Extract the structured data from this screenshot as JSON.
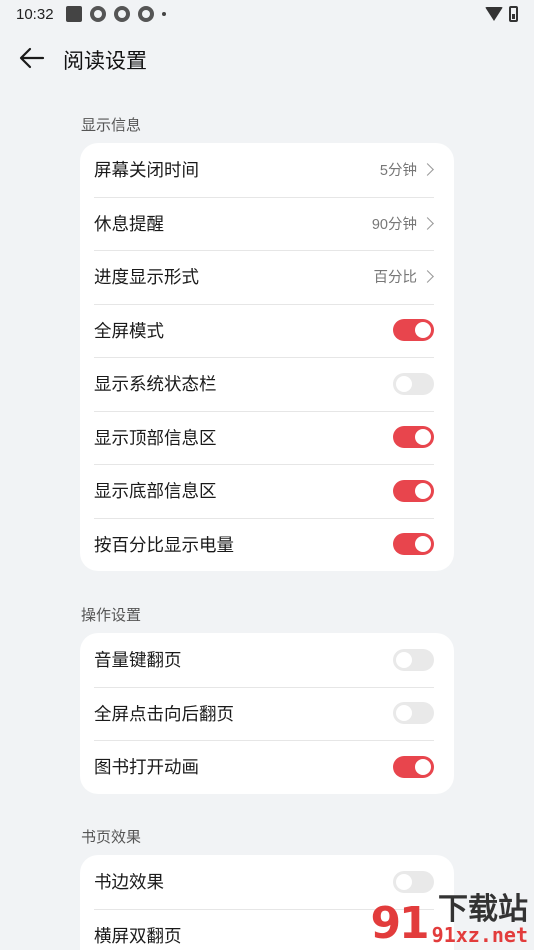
{
  "status_bar": {
    "time": "10:32"
  },
  "header": {
    "title": "阅读设置"
  },
  "sections": [
    {
      "title": "显示信息",
      "rows": [
        {
          "label": "屏幕关闭时间",
          "value": "5分钟"
        },
        {
          "label": "休息提醒",
          "value": "90分钟"
        },
        {
          "label": "进度显示形式",
          "value": "百分比"
        },
        {
          "label": "全屏模式",
          "toggle": true
        },
        {
          "label": "显示系统状态栏",
          "toggle": false
        },
        {
          "label": "显示顶部信息区",
          "toggle": true
        },
        {
          "label": "显示底部信息区",
          "toggle": true
        },
        {
          "label": "按百分比显示电量",
          "toggle": true
        }
      ]
    },
    {
      "title": "操作设置",
      "rows": [
        {
          "label": "音量键翻页",
          "toggle": false
        },
        {
          "label": "全屏点击向后翻页",
          "toggle": false
        },
        {
          "label": "图书打开动画",
          "toggle": true
        }
      ]
    },
    {
      "title": "书页效果",
      "rows": [
        {
          "label": "书边效果",
          "toggle": false
        },
        {
          "label": "横屏双翻页"
        }
      ]
    }
  ],
  "colors": {
    "accent": "#e8454d",
    "toggle_off": "#e9e9e9",
    "background": "#f1f3f5"
  },
  "watermark": {
    "logo": "91",
    "brand": "下载站",
    "url": "91xz.net"
  }
}
